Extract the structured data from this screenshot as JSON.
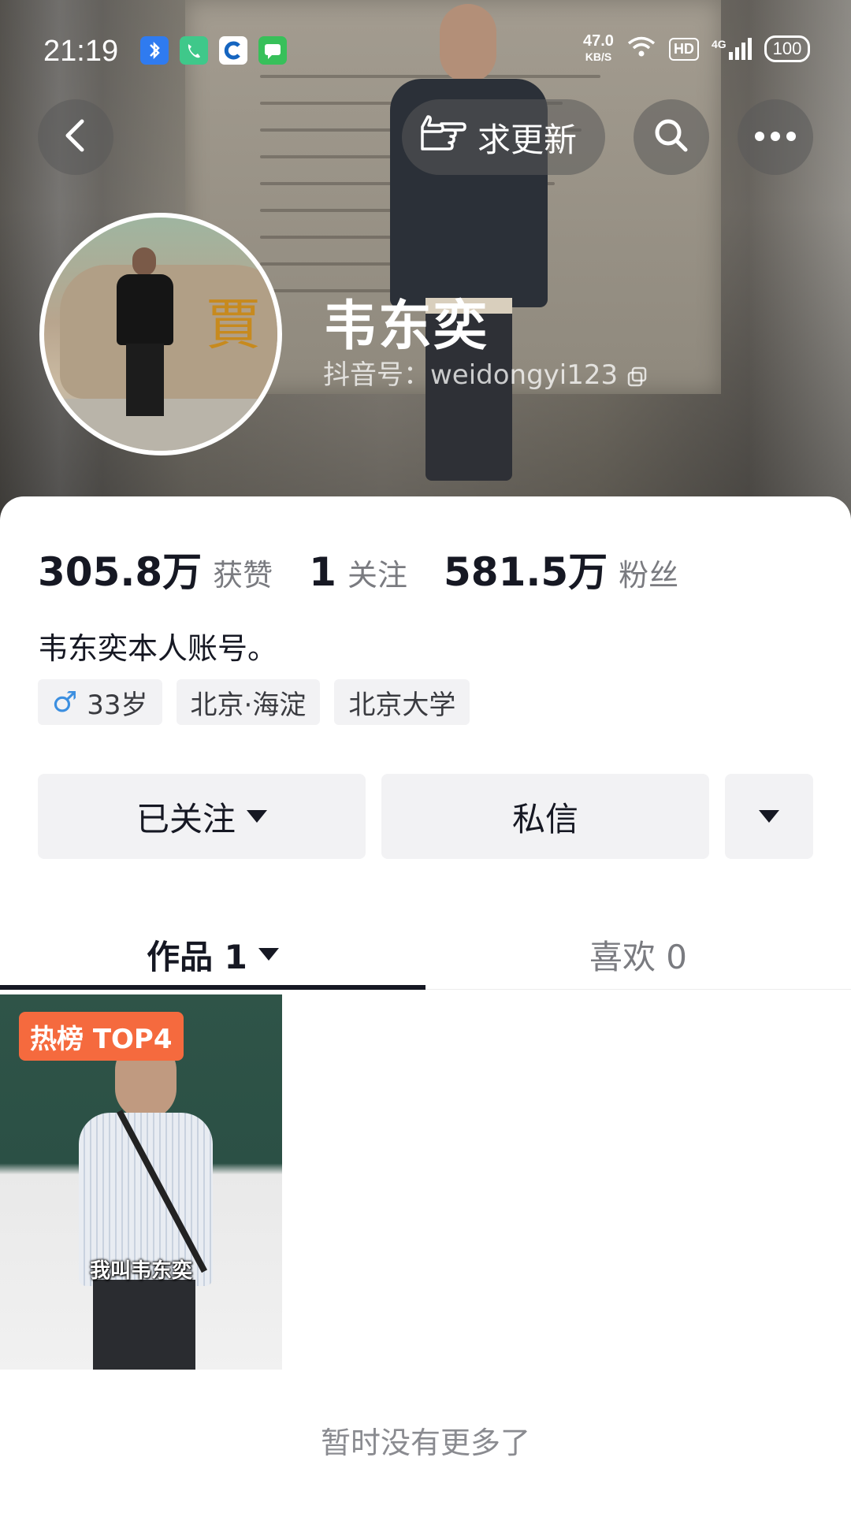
{
  "status_bar": {
    "time": "21:19",
    "net_speed": "47.0",
    "net_unit": "KB/S",
    "hd_label": "HD",
    "signal_label": "4G",
    "battery": "100",
    "app_icons": [
      "bluetooth-app-icon",
      "phone-app-icon",
      "browser-app-icon",
      "messages-app-icon"
    ]
  },
  "header": {
    "back_icon": "chevron-left-icon",
    "update_button_label": "求更新",
    "update_icon": "pointing-hand-icon",
    "search_icon": "search-icon",
    "more_icon": "more-dots-icon"
  },
  "profile": {
    "name": "韦东奕",
    "id_text": "抖音号：weidongyi123"
  },
  "stats": [
    {
      "value": "305.8万",
      "label": "获赞"
    },
    {
      "value": "1",
      "label": "关注"
    },
    {
      "value": "581.5万",
      "label": "粉丝"
    }
  ],
  "bio": "韦东奕本人账号。",
  "tags": {
    "age": "33岁",
    "location": "北京·海淀",
    "school": "北京大学"
  },
  "actions": {
    "follow_label": "已关注",
    "message_label": "私信"
  },
  "tabs": {
    "works": "作品 1",
    "likes": "喜欢 0"
  },
  "video": {
    "badge": "热榜 TOP4",
    "caption": "我叫韦东奕"
  },
  "footer": {
    "no_more": "暂时没有更多了"
  },
  "colors": {
    "accent_badge": "#f56a3e",
    "male_icon": "#3c8fe0",
    "text_primary": "#161823",
    "text_secondary": "#7a7b80"
  }
}
